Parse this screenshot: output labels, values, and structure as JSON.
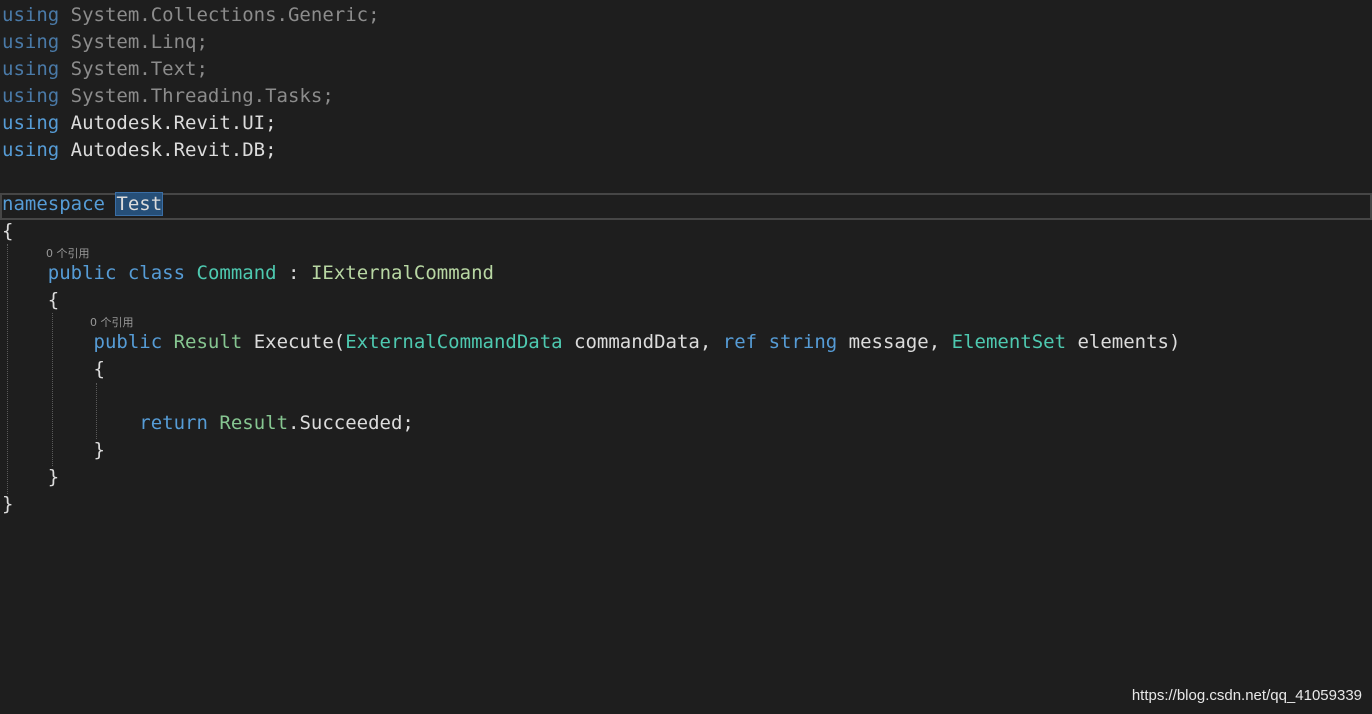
{
  "code": {
    "using_lines": [
      {
        "keyword": "using",
        "ns": "System.Collections.Generic",
        "end": ";",
        "dimmed": true
      },
      {
        "keyword": "using",
        "ns": "System.Linq",
        "end": ";",
        "dimmed": true
      },
      {
        "keyword": "using",
        "ns": "System.Text",
        "end": ";",
        "dimmed": true
      },
      {
        "keyword": "using",
        "ns": "System.Threading.Tasks",
        "end": ";",
        "dimmed": true
      },
      {
        "keyword": "using",
        "ns": "Autodesk.Revit.UI",
        "end": ";",
        "dimmed": false
      },
      {
        "keyword": "using",
        "ns": "Autodesk.Revit.DB",
        "end": ";",
        "dimmed": false
      }
    ],
    "namespace_line": {
      "keyword": "namespace",
      "name": "Test"
    },
    "class_lens": "0 个引用",
    "class_line": {
      "mod": "public",
      "kw": "class",
      "name": "Command",
      "colon": ":",
      "iface": "IExternalCommand"
    },
    "method_lens": "0 个引用",
    "method_line": {
      "mod": "public",
      "ret": "Result",
      "name": "Execute",
      "open_paren": "(",
      "p1_type": "ExternalCommandData",
      "p1_name": "commandData",
      "comma1": ",",
      "p2_ref": "ref",
      "p2_type": "string",
      "p2_name": "message",
      "comma2": ",",
      "p3_type": "ElementSet",
      "p3_name": "elements",
      "close_paren": ")"
    },
    "return_line": {
      "kw": "return",
      "enum": "Result",
      "member": ".Succeeded",
      "end": ";"
    },
    "open_brace": "{",
    "close_brace": "}"
  },
  "watermark": "https://blog.csdn.net/qq_41059339",
  "colors": {
    "background": "#1e1e1e",
    "keyword": "#569cd6",
    "type": "#4ec9b0",
    "interface": "#b8d7a3",
    "struct": "#86c691",
    "text": "#dcdcdc",
    "selection": "#264f78"
  }
}
